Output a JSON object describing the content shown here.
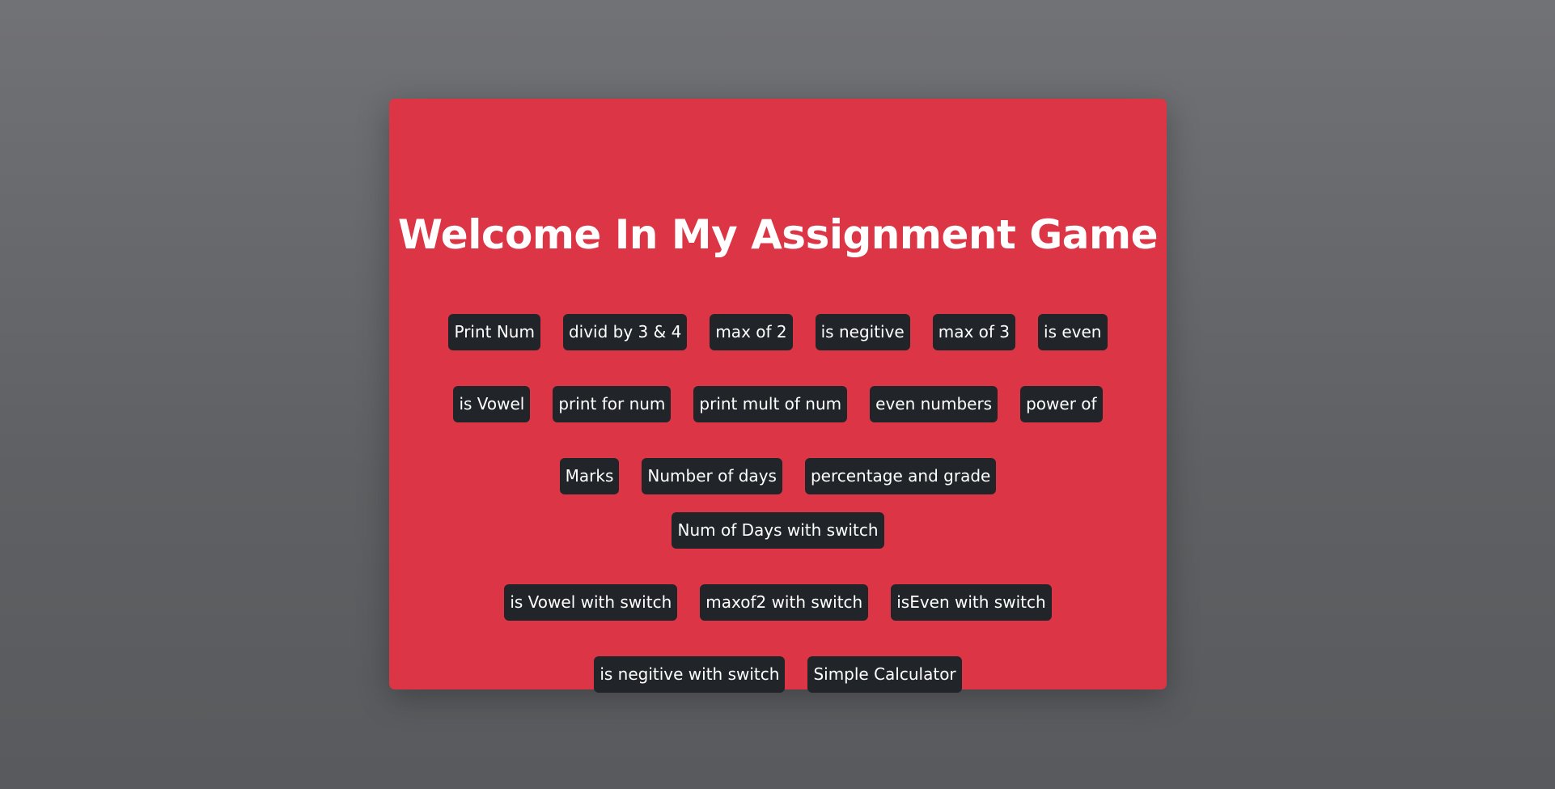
{
  "page": {
    "title": "Welcome In My Assignment Game"
  },
  "buttons": {
    "print_num": "Print Num",
    "divid_by_3_4": "divid by 3 & 4",
    "max_of_2": "max of 2",
    "is_negitive": "is negitive",
    "max_of_3": "max of 3",
    "is_even": "is even",
    "is_vowel": "is Vowel",
    "print_for_num": "print for num",
    "print_mult_of_num": "print mult of num",
    "even_numbers": "even numbers",
    "power_of": "power of",
    "marks": "Marks",
    "number_of_days": "Number of days",
    "percentage_and_grade": "percentage and grade",
    "num_of_days_with_switch": "Num of Days with switch",
    "is_vowel_with_switch": "is Vowel with switch",
    "maxof2_with_switch": "maxof2 with switch",
    "iseven_with_switch": "isEven with switch",
    "is_negitive_with_switch": "is negitive with switch",
    "simple_calculator": "Simple Calculator"
  },
  "colors": {
    "card_background": "#dc3545",
    "button_background": "#212529",
    "text": "#ffffff",
    "page_background": "#6b6c70"
  }
}
